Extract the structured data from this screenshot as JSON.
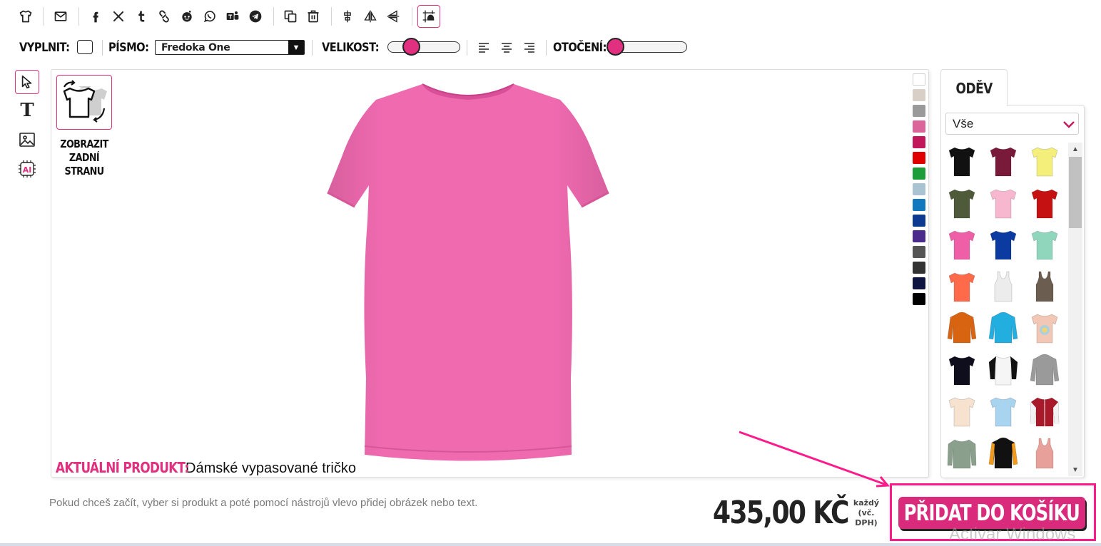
{
  "toolbar": {
    "icons": [
      "tshirt-icon",
      "envelope-icon",
      "facebook-icon",
      "x-icon",
      "tumblr-icon",
      "pinterest-icon",
      "reddit-icon",
      "whatsapp-icon",
      "teams-icon",
      "telegram-icon",
      "copy-icon",
      "trash-icon",
      "align-center-vertical-icon",
      "flip-horizontal-icon",
      "flip-vertical-icon",
      "grid-snap-icon"
    ]
  },
  "options": {
    "fill_label": "VYPLNIT:",
    "font_label": "PÍSMO:",
    "font_value": "Fredoka One",
    "size_label": "VELIKOST:",
    "size_level": 0.28,
    "rotation_label": "OTOČENÍ:",
    "rotation_level": 0.0
  },
  "tools": [
    "select-pointer-icon",
    "text-tool-icon",
    "image-tool-icon",
    "ai-tool-icon"
  ],
  "canvas": {
    "back_side_label": "ZOBRAZIT ZADNÍ STRANU",
    "current_product_label": "AKTUÁLNÍ PRODUKT:",
    "current_product_value": "Dámské vypasované tričko",
    "product_color": "#f06ab0",
    "swatches": [
      "#ffffff",
      "#d8cfc6",
      "#9a9a9a",
      "#d9659b",
      "#c2185b",
      "#e00000",
      "#1e9e3a",
      "#a9c3d3",
      "#1278be",
      "#0d3a91",
      "#4a2a8a",
      "#555555",
      "#333333",
      "#0d1540",
      "#000000"
    ]
  },
  "panel": {
    "tab_label": "ODĚV",
    "category_value": "Vše",
    "products": [
      {
        "color": "#111111",
        "kind": "tee"
      },
      {
        "color": "#7a1a3a",
        "kind": "tee"
      },
      {
        "color": "#f4ef7a",
        "kind": "tee"
      },
      {
        "color": "#4e5a3a",
        "kind": "tee"
      },
      {
        "color": "#f7b7cf",
        "kind": "tee"
      },
      {
        "color": "#c51111",
        "kind": "tee"
      },
      {
        "color": "#ee5fa8",
        "kind": "tee"
      },
      {
        "color": "#0b3aa0",
        "kind": "tee"
      },
      {
        "color": "#8fd6bd",
        "kind": "tee"
      },
      {
        "color": "#ff6a4a",
        "kind": "tee"
      },
      {
        "color": "#ececec",
        "kind": "tank"
      },
      {
        "color": "#6b5d4f",
        "kind": "tank"
      },
      {
        "color": "#d86412",
        "kind": "hoodie"
      },
      {
        "color": "#23aee0",
        "kind": "hoodie"
      },
      {
        "color": "#f2c7b5",
        "kind": "tie-dye"
      },
      {
        "color": "#0e0e1c",
        "kind": "tee"
      },
      {
        "color": "#f5f5f5",
        "kind": "raglan"
      },
      {
        "color": "#9a9a9a",
        "kind": "hoodie"
      },
      {
        "color": "#f7e2cf",
        "kind": "tee"
      },
      {
        "color": "#a9d4f0",
        "kind": "tee"
      },
      {
        "color": "#a8192a",
        "kind": "jacket"
      },
      {
        "color": "#8aa08c",
        "kind": "longsleeve"
      },
      {
        "color": "#111111",
        "kind": "hoodie"
      },
      {
        "color": "#e8a19a",
        "kind": "tank"
      }
    ]
  },
  "footer": {
    "hint": "Pokud chceš začít, vyber si produkt a poté pomocí nástrojů vlevo přidej obrázek nebo text.",
    "price": "435,00 KČ",
    "price_note": "každý (vč. DPH)",
    "add_to_cart": "PŘIDAT DO KOŠÍKU",
    "watermark": "Activar Windows"
  },
  "colors": {
    "accent": "#e0307f",
    "highlight_frame": "#ff1a8c"
  }
}
